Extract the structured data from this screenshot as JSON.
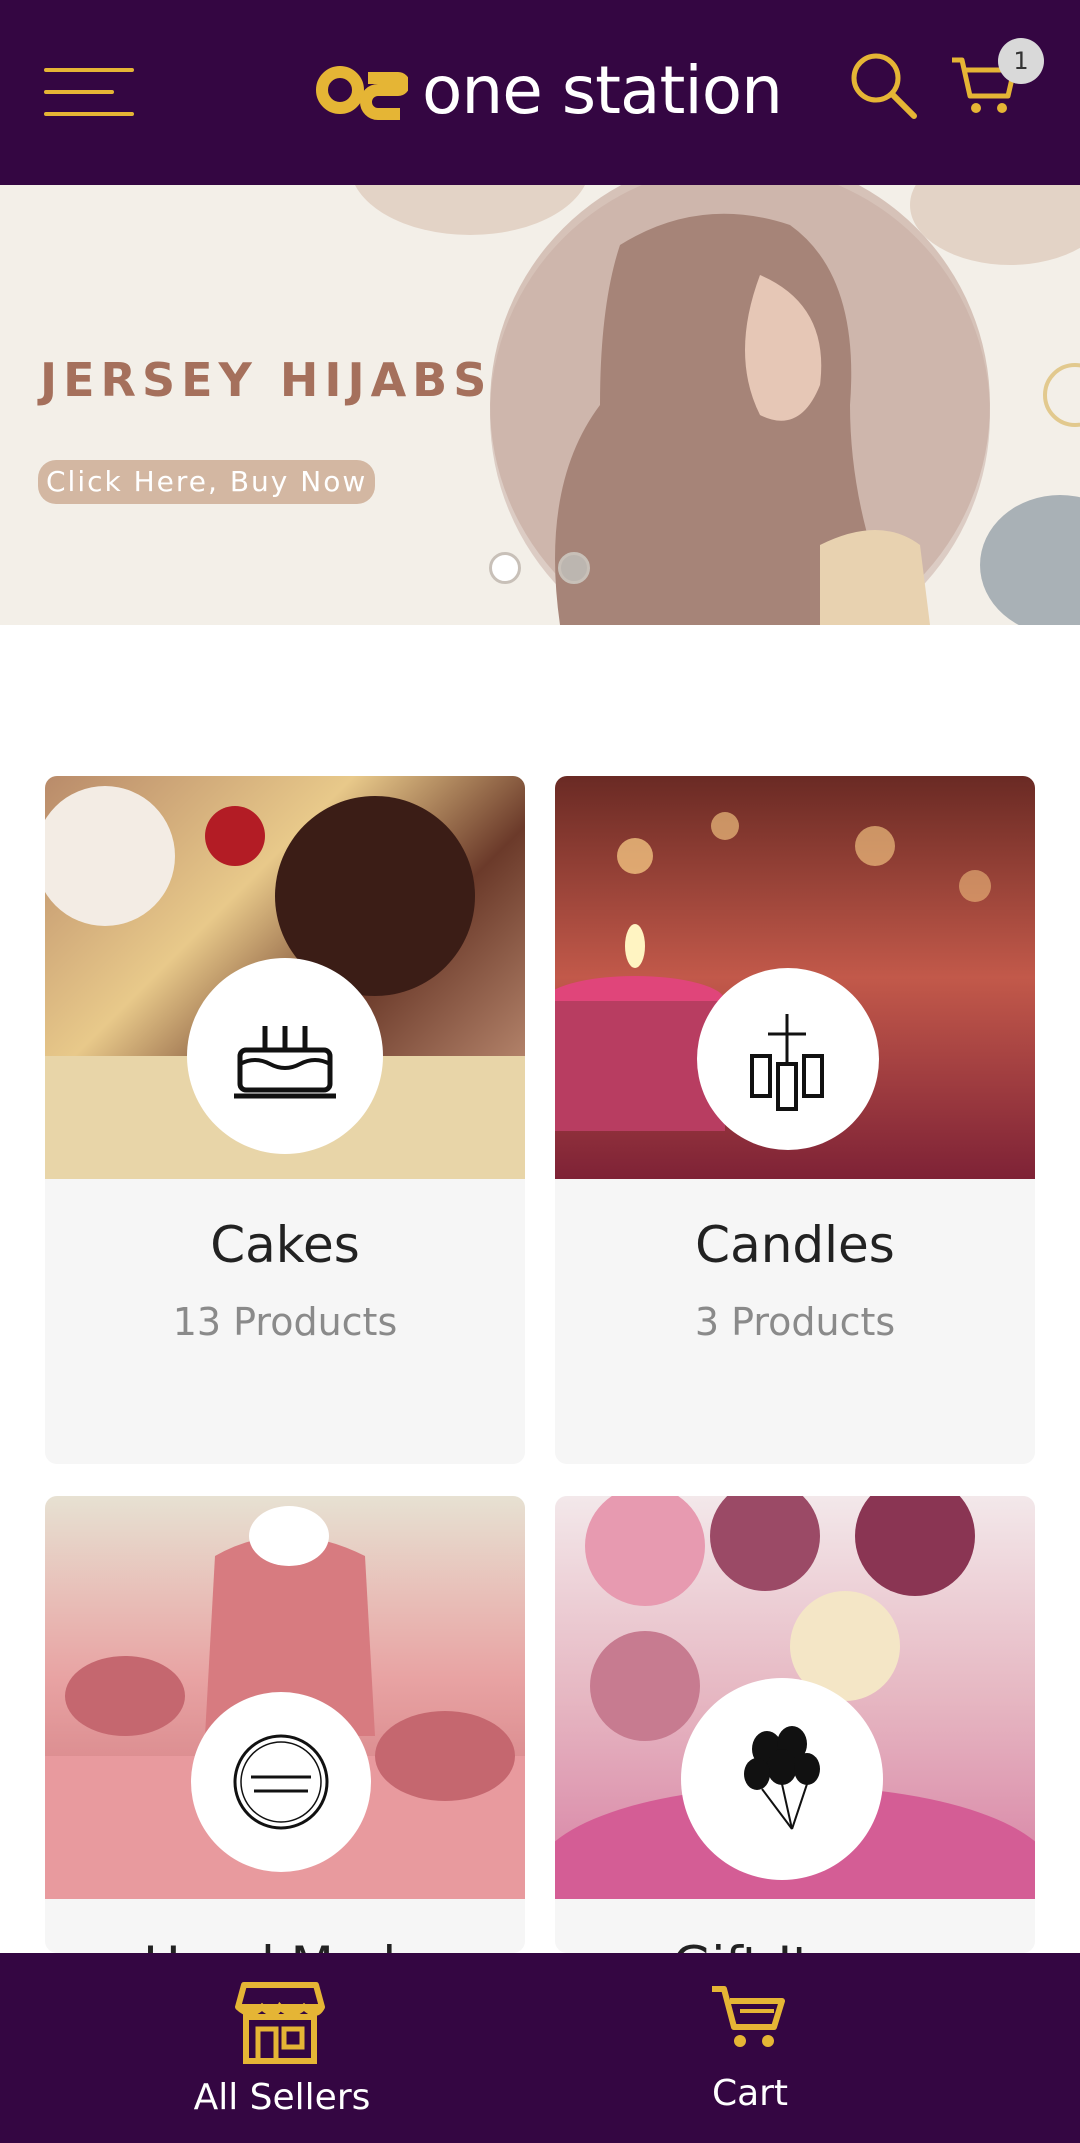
{
  "header": {
    "brand": "one station",
    "cart_count": "1",
    "colors": {
      "background": "#340642",
      "accent": "#e5b535"
    },
    "icons": [
      "menu-icon",
      "search-icon",
      "cart-icon"
    ]
  },
  "banner": {
    "title": "JERSEY HIJABS",
    "cta": "Click Here, Buy Now",
    "slides": 2,
    "active_slide": 1
  },
  "categories": [
    {
      "name": "Cakes",
      "count": "13 Products",
      "icon": "cake-icon"
    },
    {
      "name": "Candles",
      "count": "3 Products",
      "icon": "candles-icon"
    },
    {
      "name": "Hand Made",
      "count": "",
      "icon": "handmade-badge-icon"
    },
    {
      "name": "Gift Items",
      "count": "",
      "icon": "balloons-icon"
    }
  ],
  "bottom_nav": [
    {
      "label": "All Sellers",
      "icon": "store-icon"
    },
    {
      "label": "Cart",
      "icon": "cart-icon"
    }
  ]
}
